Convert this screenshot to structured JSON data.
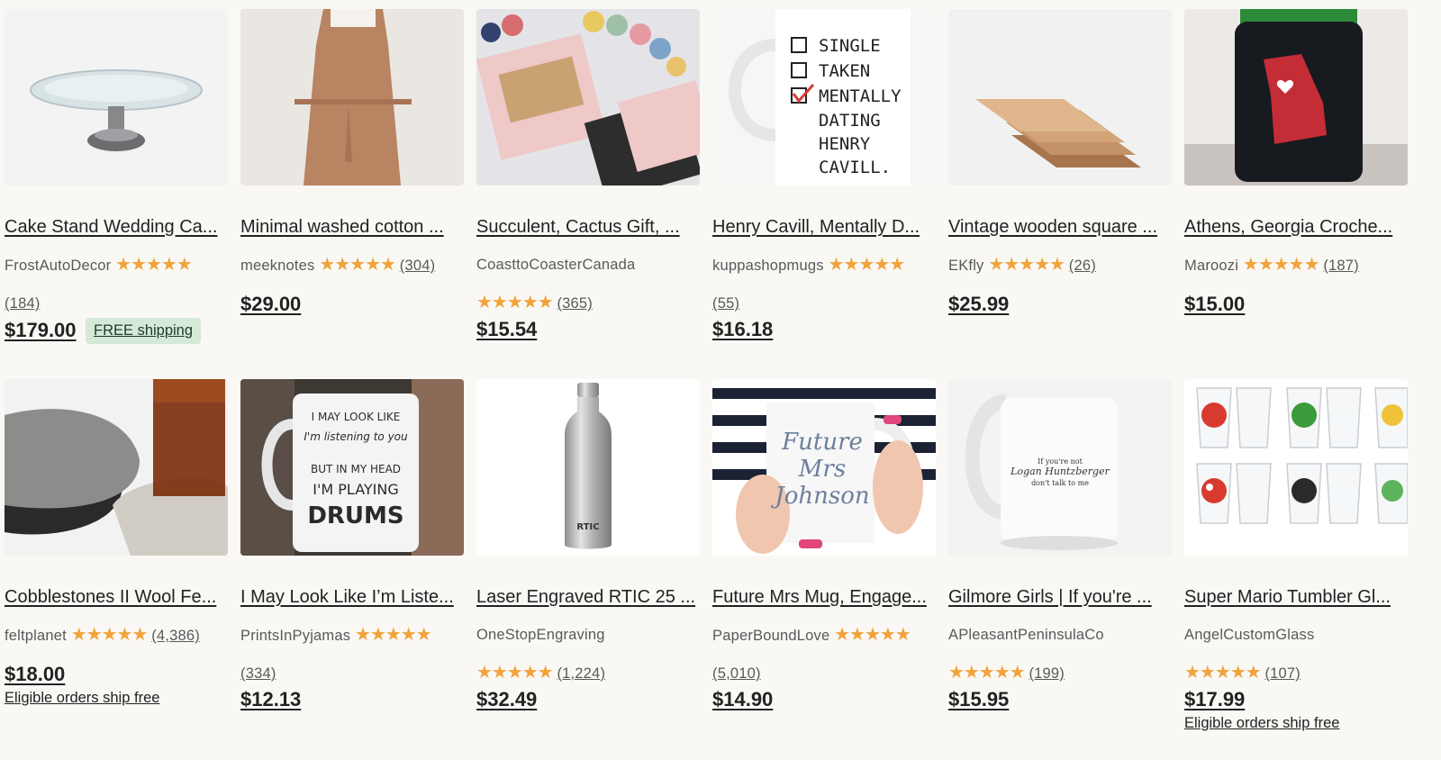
{
  "products": [
    {
      "title": "Cake Stand Wedding Ca...",
      "shop": "FrostAutoDecor",
      "stars": "★★★★★",
      "reviews": "(184)",
      "price": "$179.00",
      "badge": "FREE shipping",
      "shipping_note": ""
    },
    {
      "title": "Minimal washed cotton ...",
      "shop": "meeknotes",
      "stars": "★★★★★",
      "reviews": "(304)",
      "price": "$29.00",
      "badge": "",
      "shipping_note": ""
    },
    {
      "title": "Succulent, Cactus Gift, ...",
      "shop": "CoasttoCoasterCanada",
      "stars": "★★★★★",
      "reviews": "(365)",
      "price": "$15.54",
      "badge": "",
      "shipping_note": ""
    },
    {
      "title": "Henry Cavill, Mentally D...",
      "shop": "kuppashopmugs",
      "stars": "★★★★★",
      "reviews": "(55)",
      "price": "$16.18",
      "badge": "",
      "shipping_note": ""
    },
    {
      "title": "Vintage wooden square ...",
      "shop": "EKfly",
      "stars": "★★★★★",
      "reviews": "(26)",
      "price": "$25.99",
      "badge": "",
      "shipping_note": ""
    },
    {
      "title": "Athens, Georgia Croche...",
      "shop": "Maroozi",
      "stars": "★★★★★",
      "reviews": "(187)",
      "price": "$15.00",
      "badge": "",
      "shipping_note": ""
    },
    {
      "title": "Cobblestones II Wool Fe...",
      "shop": "feltplanet",
      "stars": "★★★★★",
      "reviews": "(4,386)",
      "price": "$18.00",
      "badge": "",
      "shipping_note": "Eligible orders ship free"
    },
    {
      "title": "I May Look Like I’m Liste...",
      "shop": "PrintsInPyjamas",
      "stars": "★★★★★",
      "reviews": "(334)",
      "price": "$12.13",
      "badge": "",
      "shipping_note": ""
    },
    {
      "title": "Laser Engraved RTIC 25 ...",
      "shop": "OneStopEngraving",
      "stars": "★★★★★",
      "reviews": "(1,224)",
      "price": "$32.49",
      "badge": "",
      "shipping_note": ""
    },
    {
      "title": "Future Mrs Mug, Engage...",
      "shop": "PaperBoundLove",
      "stars": "★★★★★",
      "reviews": "(5,010)",
      "price": "$14.90",
      "badge": "",
      "shipping_note": ""
    },
    {
      "title": "Gilmore Girls | If you're ...",
      "shop": "APleasantPeninsulaCo",
      "stars": "★★★★★",
      "reviews": "(199)",
      "price": "$15.95",
      "badge": "",
      "shipping_note": ""
    },
    {
      "title": "Super Mario Tumbler Gl...",
      "shop": "AngelCustomGlass",
      "stars": "★★★★★",
      "reviews": "(107)",
      "price": "$17.99",
      "badge": "",
      "shipping_note": "Eligible orders ship free"
    }
  ],
  "image_text": {
    "mug_checklist": [
      "SINGLE",
      "TAKEN",
      "MENTALLY",
      "DATING",
      "HENRY",
      "CAVILL."
    ],
    "drums_mug": [
      "I MAY LOOK LIKE",
      "I'm listening to you",
      "BUT IN MY HEAD",
      "I'M PLAYING",
      "DRUMS"
    ],
    "future_mug": [
      "Future",
      "Mrs",
      "Johnson"
    ],
    "gilmore_mug": [
      "If you're not",
      "Logan Huntzberger",
      "don't talk to me"
    ],
    "bottle_brand": "RTIC"
  },
  "colors": {
    "accent_star": "#f1a33a",
    "badge_bg": "#d4e9d7",
    "background": "#faf8f5"
  }
}
